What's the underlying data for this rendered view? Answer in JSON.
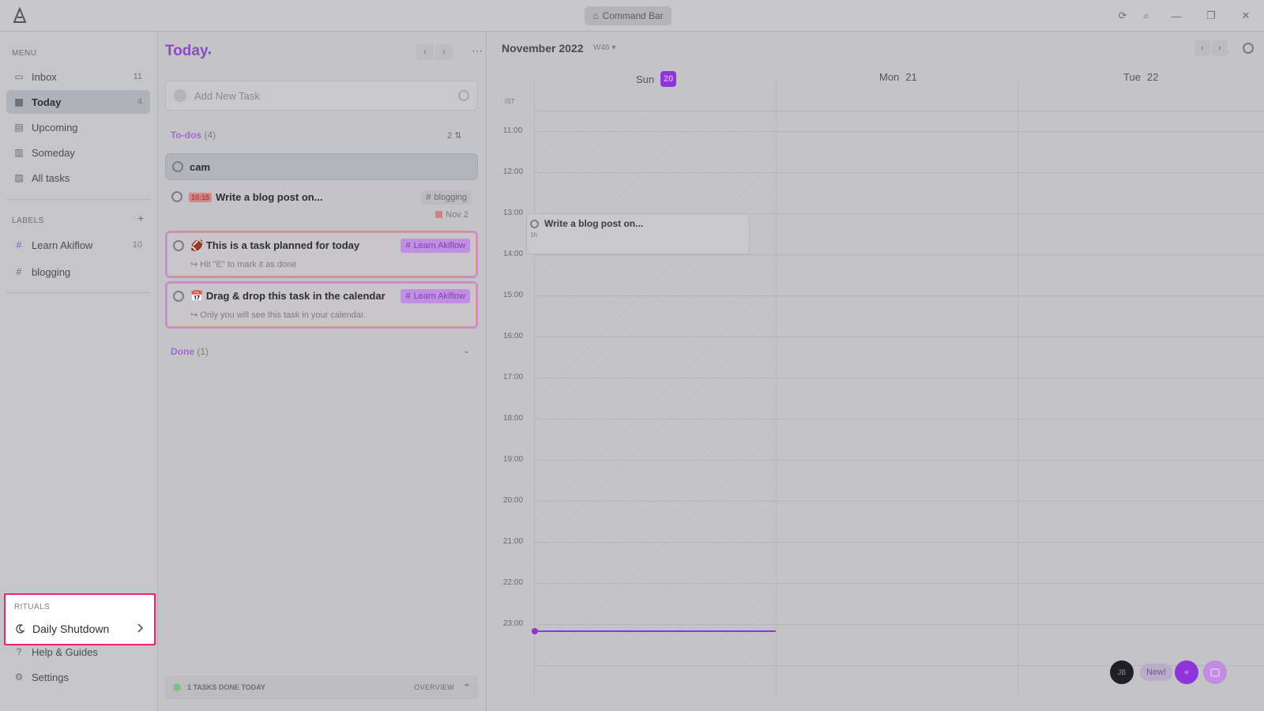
{
  "titlebar": {
    "command_bar": "Command Bar"
  },
  "sidebar": {
    "menu_label": "MENU",
    "items": [
      {
        "label": "Inbox",
        "count": "11",
        "icon": "inbox-icon"
      },
      {
        "label": "Today",
        "count": "4",
        "icon": "today-icon"
      },
      {
        "label": "Upcoming",
        "count": "",
        "icon": "upcoming-icon"
      },
      {
        "label": "Someday",
        "count": "",
        "icon": "someday-icon"
      },
      {
        "label": "All tasks",
        "count": "",
        "icon": "all-tasks-icon"
      }
    ],
    "labels_label": "LABELS",
    "labels": [
      {
        "label": "Learn Akiflow",
        "count": "10",
        "color": "#9b4cd6"
      },
      {
        "label": "blogging",
        "count": "",
        "color": "#8a8a8e"
      }
    ],
    "rituals": {
      "label": "RITUALS",
      "item": "Daily Shutdown"
    },
    "bottom": [
      {
        "label": "Help & Guides"
      },
      {
        "label": "Settings"
      }
    ]
  },
  "tasklist": {
    "title": "Today",
    "add_placeholder": "Add New Task",
    "todos_header": "To-dos",
    "todos_count": "(4)",
    "todos_right": "2",
    "tasks": [
      {
        "title": "cam",
        "sub": ""
      },
      {
        "time_tag": "10:15",
        "title": "Write a blog post on...",
        "sub": "",
        "label": "blogging",
        "date": "Nov 2"
      },
      {
        "title": "This is a task planned for today",
        "emoji": "🏈",
        "sub": "Hit \"E\" to mark it as done",
        "label": "Learn Akiflow"
      },
      {
        "title": "Drag & drop this task in the calendar",
        "emoji": "📅",
        "sub": "Only you will see this task in your calendar.",
        "label": "Learn Akiflow"
      }
    ],
    "done_header": "Done",
    "done_count": "(1)",
    "footer": {
      "text": "1 TASKS DONE TODAY",
      "overview": "OVERVIEW"
    }
  },
  "calendar": {
    "title": "November 2022",
    "subtitle": "W46",
    "tz": "IST",
    "days": [
      {
        "name": "Sun",
        "num": "20",
        "today": true
      },
      {
        "name": "Mon",
        "num": "21",
        "today": false
      },
      {
        "name": "Tue",
        "num": "22",
        "today": false
      }
    ],
    "hours": [
      "11:00",
      "12:00",
      "13:00",
      "14:00",
      "15:00",
      "16:00",
      "17:00",
      "18:00",
      "19:00",
      "20:00",
      "21:00",
      "22:00",
      "23:00"
    ],
    "event": {
      "title": "Write a blog post on...",
      "time": "1h"
    },
    "avatar": "JB",
    "new_label": "New!",
    "accent": "#8e34d9"
  }
}
